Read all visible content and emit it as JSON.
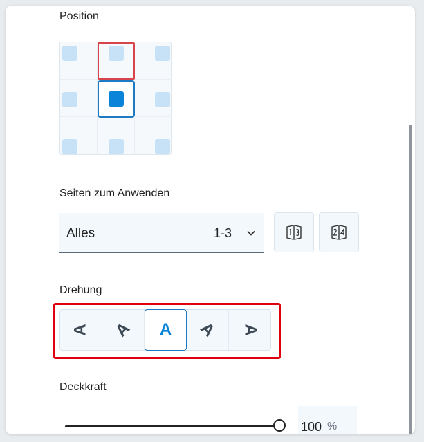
{
  "position": {
    "label": "Position",
    "cells": [
      "top-left",
      "top-center",
      "top-right",
      "middle-left",
      "middle-center",
      "middle-right",
      "bottom-left",
      "bottom-center",
      "bottom-right"
    ],
    "selected": "middle-center",
    "hovered": "top-center"
  },
  "pages": {
    "label": "Seiten zum Anwenden",
    "value": "Alles",
    "range": "1-3"
  },
  "rotation": {
    "label": "Drehung",
    "glyph": "A",
    "angles_deg": [
      -90,
      -45,
      0,
      45,
      90
    ],
    "selected_deg": 0
  },
  "opacity": {
    "label": "Deckkraft",
    "value": "100",
    "unit": "%",
    "level": 1.0
  },
  "colors": {
    "accent": "#0a84d8",
    "highlight": "#e0000f"
  }
}
